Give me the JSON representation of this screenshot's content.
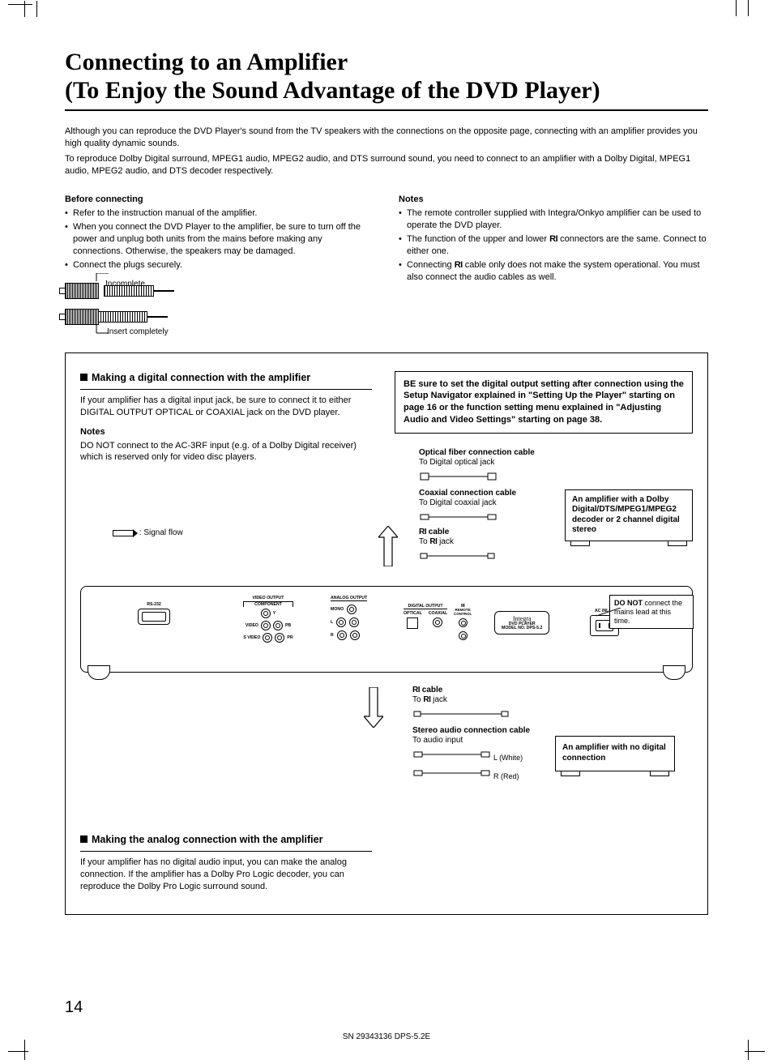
{
  "title_line1": "Connecting to an Amplifier",
  "title_line2": "(To Enjoy the Sound Advantage of the DVD Player)",
  "intro": {
    "p1": "Although you can reproduce the DVD Player's sound from the TV speakers with the connections on the opposite page, connecting with an amplifier provides you high quality dynamic sounds.",
    "p2": "To reproduce Dolby Digital surround, MPEG1 audio, MPEG2 audio, and DTS surround sound, you need to connect to an amplifier with a Dolby Digital, MPEG1 audio, MPEG2 audio, and DTS decoder respectively."
  },
  "before_connecting": {
    "heading": "Before connecting",
    "items": [
      "Refer to the instruction manual of the amplifier.",
      "When you connect the DVD Player to the amplifier, be sure to turn off the power and unplug both units from the mains before making any connections. Otherwise, the speakers may be damaged.",
      "Connect the plugs securely."
    ],
    "plug_incomplete": "Incomplete",
    "plug_complete": "Insert completely"
  },
  "notes_col": {
    "heading": "Notes",
    "items": [
      "The remote controller supplied with Integra/Onkyo amplifier can be used to operate the DVD player.",
      "The function of the upper and lower RI connectors are the same. Connect to either one.",
      "Connecting RI cable only does not make the system operational. You must also connect the audio cables as well."
    ]
  },
  "digital_section": {
    "title": "Making a digital connection with the amplifier",
    "body": "If your amplifier has a digital input jack, be sure to connect it to either DIGITAL OUTPUT OPTICAL or COAXIAL jack on the DVD player.",
    "notes_heading": "Notes",
    "notes_body": "DO NOT connect to the AC-3RF input (e.g. of a Dolby Digital receiver) which is reserved only for video disc players."
  },
  "setup_note": "BE sure to set the digital output setting after connection using the Setup Navigator explained in \"Setting Up the Player\" starting on page 16 or the function setting menu explained in \"Adjusting Audio and Video Settings\" starting on page 38.",
  "cables": {
    "optical_title": "Optical fiber connection cable",
    "optical_sub": "To Digital optical jack",
    "coax_title": "Coaxial connection cable",
    "coax_sub": "To Digital coaxial jack",
    "ri_title": "RI cable",
    "ri_sub": "To RI jack",
    "stereo_title": "Stereo audio connection cable",
    "stereo_sub": "To audio input",
    "l_white": "L (White)",
    "r_red": "R (Red)"
  },
  "amps": {
    "digital": "An amplifier with a Dolby Digital/DTS/MPEG1/MPEG2 decoder or 2 channel digital stereo",
    "analog": "An amplifier with no digital connection",
    "do_not_mains": "DO NOT connect the mains lead at this time."
  },
  "signal_flow": ": Signal flow",
  "panel": {
    "rs232": "RS-232",
    "video_output": "VIDEO OUTPUT",
    "component": "COMPONENT",
    "analog_output": "ANALOG OUTPUT",
    "digital_output": "DIGITAL OUTPUT",
    "optical": "OPTICAL",
    "coaxial": "COAXIAL",
    "ri_remote": "RI REMOTE CONTROL",
    "brand": "Integra",
    "model_label": "DVD PLAYER",
    "model_no": "MODEL NO. DPS-5.2",
    "ac_inlet": "AC INLET",
    "video": "VIDEO",
    "s_video": "S VIDEO",
    "mono": "MONO",
    "y": "Y",
    "pb": "PB",
    "pr": "PR",
    "l": "L",
    "r": "R"
  },
  "analog_section": {
    "title": "Making the analog connection with the amplifier",
    "body": "If your amplifier has no digital audio input, you can make the analog connection. If the amplifier has a Dolby Pro Logic decoder, you can reproduce the Dolby Pro Logic surround sound."
  },
  "page_number": "14",
  "doc_id": "SN 29343136 DPS-5.2E"
}
